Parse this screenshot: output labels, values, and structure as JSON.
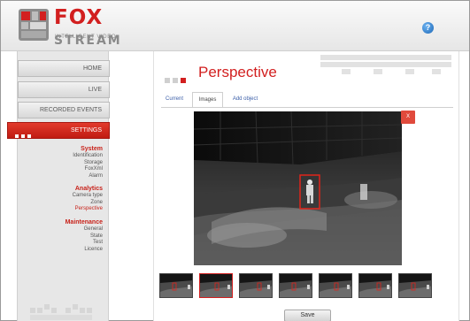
{
  "header": {
    "brand_primary": "FOX",
    "brand_secondary": "STREAM",
    "tagline": "INTELLIGENT VIDEO",
    "help_icon_glyph": "?"
  },
  "colors": {
    "brand_red": "#d21f1f",
    "nav_active": "#c01b12",
    "link_blue": "#3b5ea8",
    "help_blue": "#1c67b6"
  },
  "sidebar": {
    "nav": [
      {
        "label": "HOME"
      },
      {
        "label": "LIVE"
      },
      {
        "label": "RECORDED EVENTS"
      },
      {
        "label": "SETTINGS",
        "active": true
      }
    ],
    "groups": [
      {
        "title": "System",
        "items": [
          "Identification",
          "Storage",
          "FoxXml",
          "Alarm"
        ]
      },
      {
        "title": "Analytics",
        "items": [
          "Camera type",
          "Zone",
          "Perspective"
        ]
      },
      {
        "title": "Maintenance",
        "items": [
          "General",
          "State",
          "Test",
          "Licence"
        ]
      }
    ]
  },
  "main": {
    "title": "Perspective",
    "tabs": [
      {
        "label": "Current"
      },
      {
        "label": "Images",
        "active": true
      },
      {
        "label": "Add object"
      }
    ],
    "close_label": "X",
    "thumbnail_count": 7,
    "selected_thumbnail": 2,
    "save_label": "Save"
  },
  "icons": {
    "help": "help-icon",
    "close": "close-icon",
    "logo": "foxstream-logo-icon"
  }
}
